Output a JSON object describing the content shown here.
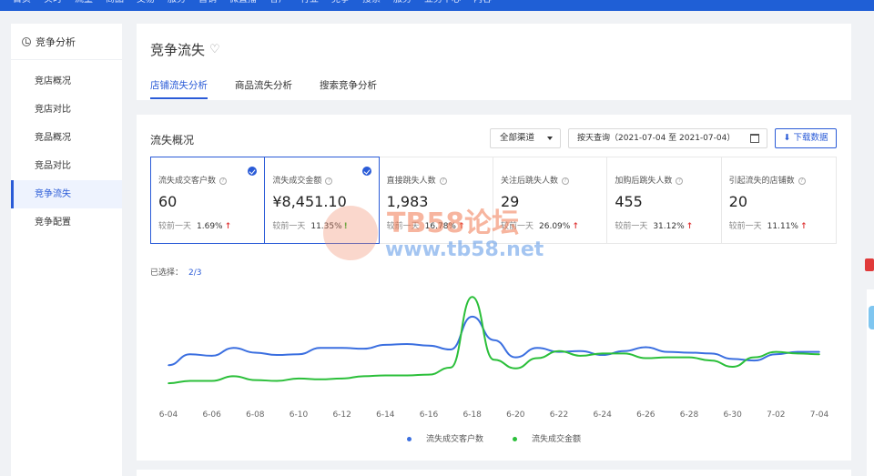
{
  "topnav": [
    "首页",
    "实时",
    "流量",
    "商品",
    "交易",
    "服务",
    "营销",
    "微直播",
    "客户",
    "行业",
    "竞争",
    "搜索",
    "服务",
    "业务中心",
    "内容"
  ],
  "sidebar": {
    "title": "竞争分析",
    "items": [
      {
        "label": "竞店概况",
        "active": false
      },
      {
        "label": "竞店对比",
        "active": false
      },
      {
        "label": "竞品概况",
        "active": false
      },
      {
        "label": "竞品对比",
        "active": false
      },
      {
        "label": "竞争流失",
        "active": true
      },
      {
        "label": "竞争配置",
        "active": false
      }
    ]
  },
  "header": {
    "title": "竞争流失",
    "tabs": [
      {
        "label": "店铺流失分析",
        "active": true
      },
      {
        "label": "商品流失分析",
        "active": false
      },
      {
        "label": "搜索竞争分析",
        "active": false
      }
    ]
  },
  "panel": {
    "title": "流失概况",
    "channel_select": "全部渠道",
    "date_range": "按天查询（2021-07-04 至 2021-07-04）",
    "download_label": "下载数据",
    "metrics": [
      {
        "label": "流失成交客户数",
        "value": "60",
        "compare_label": "较前一天",
        "pct": "1.69%",
        "trend": "up",
        "selected": true
      },
      {
        "label": "流失成交金额",
        "value": "¥8,451.10",
        "compare_label": "较前一天",
        "pct": "11.35%",
        "trend": "down",
        "selected": true
      },
      {
        "label": "直接跳失人数",
        "value": "1,983",
        "compare_label": "较前一天",
        "pct": "16.78%",
        "trend": "up",
        "selected": false
      },
      {
        "label": "关注后跳失人数",
        "value": "29",
        "compare_label": "较前一天",
        "pct": "26.09%",
        "trend": "up",
        "selected": false
      },
      {
        "label": "加购后跳失人数",
        "value": "455",
        "compare_label": "较前一天",
        "pct": "31.12%",
        "trend": "up",
        "selected": false
      },
      {
        "label": "引起流失的店铺数",
        "value": "20",
        "compare_label": "较前一天",
        "pct": "11.11%",
        "trend": "up",
        "selected": false
      }
    ],
    "selected_label": "已选择：",
    "selected_count": "2/3"
  },
  "watermark": {
    "line1": "TB58论坛",
    "line2": "www.tb58.net"
  },
  "colors": {
    "accent": "#2a5bd7",
    "series1": "#3b6fe0",
    "series2": "#2bbf3a",
    "up": "#e03a3a",
    "down": "#2bb32b"
  },
  "chart_data": {
    "type": "line",
    "x": [
      "6-04",
      "6-05",
      "6-06",
      "6-07",
      "6-08",
      "6-09",
      "6-10",
      "6-11",
      "6-12",
      "6-13",
      "6-14",
      "6-15",
      "6-16",
      "6-17",
      "6-18",
      "6-19",
      "6-20",
      "6-21",
      "6-22",
      "6-23",
      "6-24",
      "6-25",
      "6-26",
      "6-27",
      "6-28",
      "6-29",
      "6-30",
      "7-01",
      "7-02",
      "7-03",
      "7-04"
    ],
    "x_ticks": [
      "6-04",
      "6-06",
      "6-08",
      "6-10",
      "6-12",
      "6-14",
      "6-16",
      "6-18",
      "6-20",
      "6-22",
      "6-24",
      "6-26",
      "6-28",
      "6-30",
      "7-02",
      "7-04"
    ],
    "series": [
      {
        "name": "流失成交客户数",
        "values": [
          38,
          52,
          50,
          60,
          54,
          51,
          52,
          60,
          60,
          59,
          64,
          65,
          63,
          58,
          100,
          70,
          48,
          60,
          55,
          56,
          51,
          56,
          61,
          55,
          54,
          53,
          46,
          44,
          52,
          55,
          55
        ]
      },
      {
        "name": "流失成交金额",
        "values": [
          15,
          18,
          18,
          24,
          19,
          18,
          21,
          20,
          21,
          24,
          25,
          25,
          26,
          35,
          125,
          45,
          34,
          47,
          56,
          50,
          53,
          53,
          47,
          48,
          48,
          44,
          36,
          48,
          55,
          53,
          52
        ]
      }
    ],
    "ylim": [
      0,
      130
    ],
    "grid": false,
    "legend": "bottom-center"
  }
}
